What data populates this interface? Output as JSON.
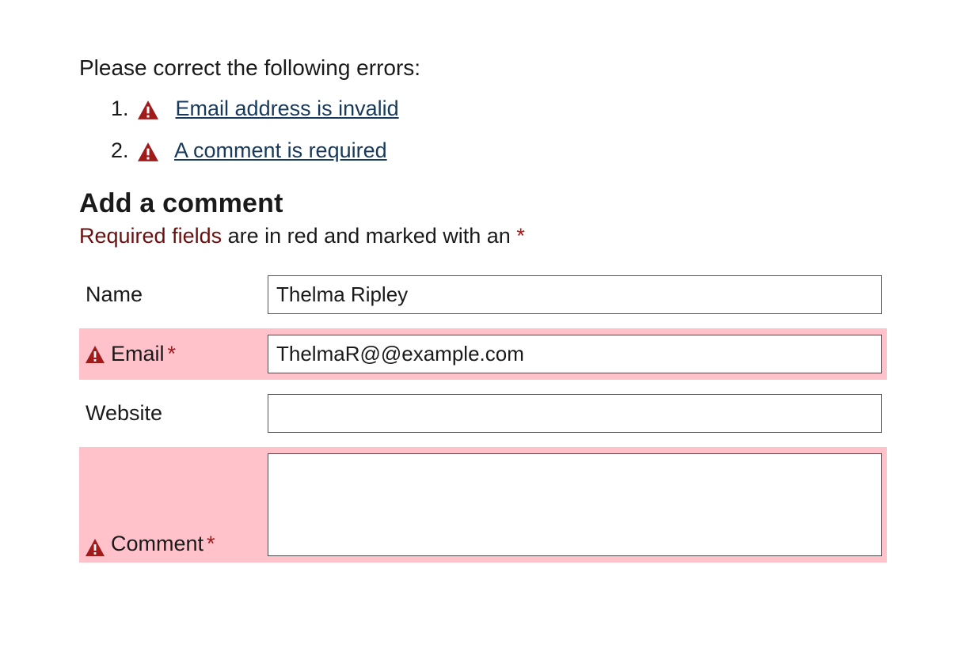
{
  "errors": {
    "title": "Please correct the following errors:",
    "items": [
      {
        "text": "Email address is invalid"
      },
      {
        "text": "A comment is required"
      }
    ]
  },
  "heading": "Add a comment",
  "required_note": {
    "prefix": "Required fields",
    "rest": " are in red and marked with an ",
    "star": "*"
  },
  "fields": {
    "name": {
      "label": "Name",
      "value": "Thelma Ripley"
    },
    "email": {
      "label": "Email ",
      "star": "*",
      "value": "ThelmaR@@example.com"
    },
    "website": {
      "label": "Website",
      "value": ""
    },
    "comment": {
      "label": "Comment ",
      "star": "*",
      "value": ""
    }
  }
}
